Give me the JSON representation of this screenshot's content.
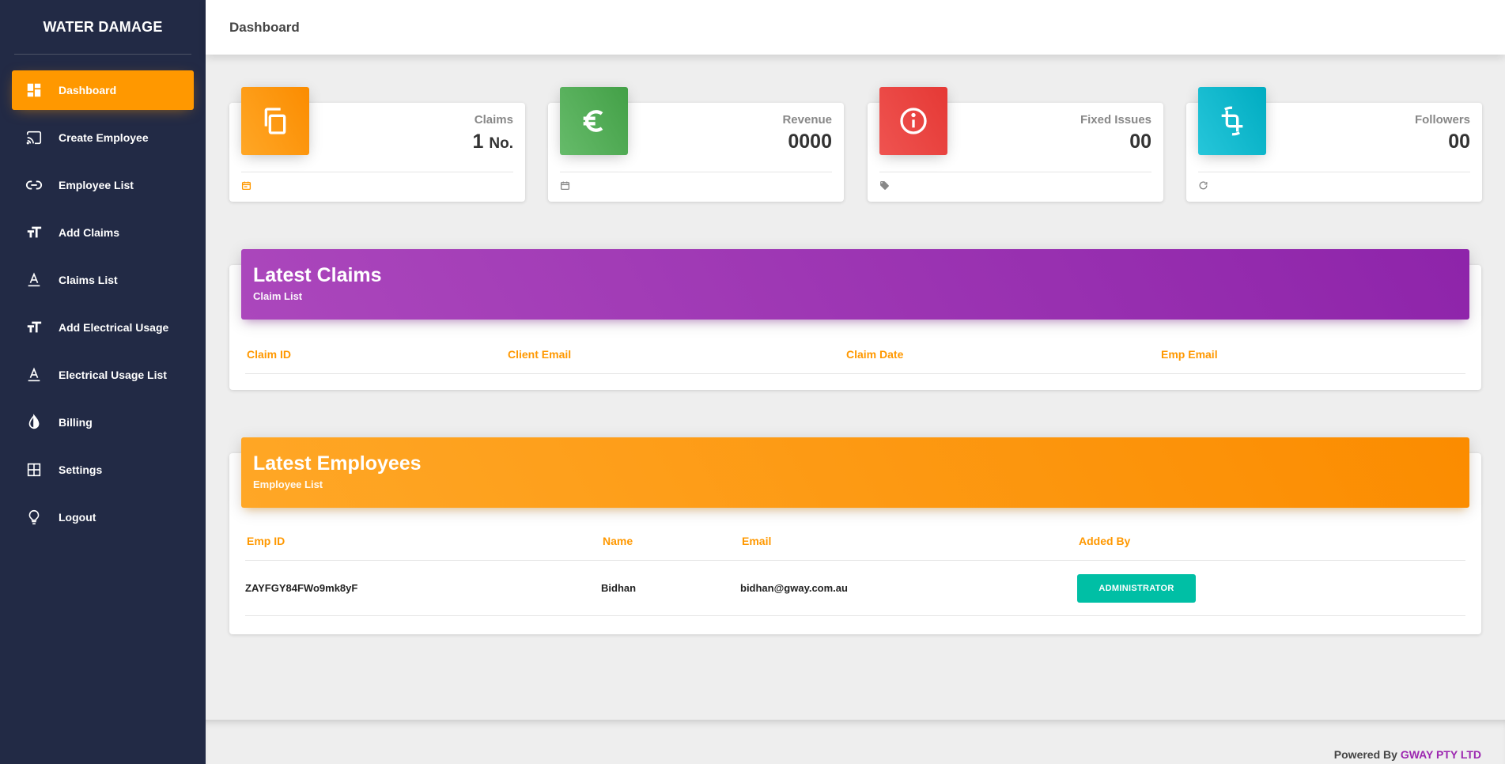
{
  "app": {
    "brand": "WATER DAMAGE"
  },
  "header": {
    "title": "Dashboard"
  },
  "sidebar": {
    "items": [
      {
        "label": "Dashboard",
        "icon": "dashboard-icon",
        "active": true
      },
      {
        "label": "Create Employee",
        "icon": "cast-icon"
      },
      {
        "label": "Employee List",
        "icon": "link-icon"
      },
      {
        "label": "Add Claims",
        "icon": "text-size-icon"
      },
      {
        "label": "Claims List",
        "icon": "text-format-icon"
      },
      {
        "label": "Add Electrical Usage",
        "icon": "text-size-icon"
      },
      {
        "label": "Electrical Usage List",
        "icon": "text-format-icon"
      },
      {
        "label": "Billing",
        "icon": "contrast-icon"
      },
      {
        "label": "Settings",
        "icon": "grid-icon"
      },
      {
        "label": "Logout",
        "icon": "lightbulb-icon"
      }
    ]
  },
  "stats": [
    {
      "label": "Claims",
      "value": "1",
      "unit": "No.",
      "color": "#ff9800",
      "icon": "copy-icon",
      "footer_icon": "calendar-icon"
    },
    {
      "label": "Revenue",
      "value": "0000",
      "color": "#4caf50",
      "icon": "euro-icon",
      "footer_icon": "calendar-icon"
    },
    {
      "label": "Fixed Issues",
      "value": "00",
      "color": "#e53935",
      "icon": "info-icon",
      "footer_icon": "tag-icon"
    },
    {
      "label": "Followers",
      "value": "00",
      "color": "#00acc1",
      "icon": "crop-rotate-icon",
      "footer_icon": "refresh-icon"
    }
  ],
  "claims_card": {
    "title": "Latest Claims",
    "subtitle": "Claim List",
    "color": "#9c27b0",
    "columns": [
      "Claim ID",
      "Client Email",
      "Claim Date",
      "Emp Email"
    ],
    "rows": []
  },
  "employees_card": {
    "title": "Latest Employees",
    "subtitle": "Employee List",
    "color": "#ff9800",
    "columns": [
      "Emp ID",
      "Name",
      "Email",
      "Added By"
    ],
    "rows": [
      {
        "emp_id": "ZAYFGY84FWo9mk8yF",
        "name": "Bidhan",
        "email": "bidhan@gway.com.au",
        "added_by": "ADMINISTRATOR"
      }
    ]
  },
  "footer": {
    "prefix": "Powered By",
    "company": "GWAY PTY LTD"
  }
}
